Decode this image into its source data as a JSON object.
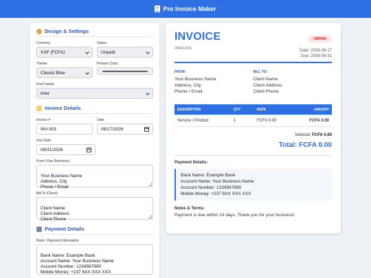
{
  "app": {
    "title": "Pro Invoice Maker"
  },
  "design": {
    "section_title": "Design & Settings",
    "currency_label": "Currency",
    "currency_value": "XAF (FCFA)",
    "status_label": "Status",
    "status_value": "Unpaid",
    "theme_label": "Theme",
    "theme_value": "Classic Blue",
    "primary_color_label": "Primary Color",
    "primary_color_value": "#2f6fe4",
    "font_family_label": "Font Family",
    "font_family_value": "Inter"
  },
  "details": {
    "section_title": "Invoice Details",
    "invoice_num_label": "Invoice #",
    "invoice_num_value": "INV-001",
    "date_label": "Date",
    "date_value": "08/17/2026",
    "due_date_label": "Due Date",
    "due_date_value": "08/31/2026",
    "from_label": "From (Your Business)",
    "from_value": "Your Business Name\nAddress, City\nPhone / Email",
    "bill_to_label": "Bill To (Client)",
    "bill_to_value": "Client Name\nClient Address\nClient Phone"
  },
  "payment": {
    "section_title": "Payment Details",
    "info_label": "Bank / Payment Information",
    "info_value": "Bank Name: Example Bank\nAccount Name: Your Business Name\nAccount Number: 1234567890\nMobile Money: +237 6XX XXX XXX"
  },
  "preview": {
    "title": "INVOICE",
    "number": "#INV-001",
    "status_badge": "UNPAID",
    "date_line": "Date: 2026-08-17",
    "due_line": "Due: 2026-08-31",
    "from_label": "FROM:",
    "from_text": "Your Business Name\nAddress, City\nPhone / Email",
    "bill_to_label": "BILL TO:",
    "bill_to_text": "Client Name\nClient Address\nClient Phone",
    "table": {
      "headers": {
        "description": "DESCRIPTION",
        "qty": "QTY",
        "rate": "RATE",
        "amount": "AMOUNT"
      },
      "rows": [
        {
          "description": "Service / Product",
          "qty": "1",
          "rate": "FCFA 0.00",
          "amount": "FCFA 0.00"
        }
      ]
    },
    "subtotal_label": "Subtotal:",
    "subtotal_value": "FCFA 0.00",
    "total_text": "Total: FCFA 0.00",
    "payment_title": "Payment Details:",
    "payment_text": "Bank Name: Example Bank\nAccount Name: Your Business Name\nAccount Number: 1234567890\nMobile Money: +237 6XX XXX XXX",
    "notes_title": "Notes & Terms:",
    "notes_text": "Payment is due within 14 days. Thank you for your business!"
  },
  "colors": {
    "accent": "#2f6fe4",
    "badge_bg": "#fde2e2",
    "badge_text": "#c62828"
  },
  "icons": {
    "header": "document-icon",
    "design": "palette-icon",
    "details": "memo-icon",
    "payment": "bank-icon"
  }
}
